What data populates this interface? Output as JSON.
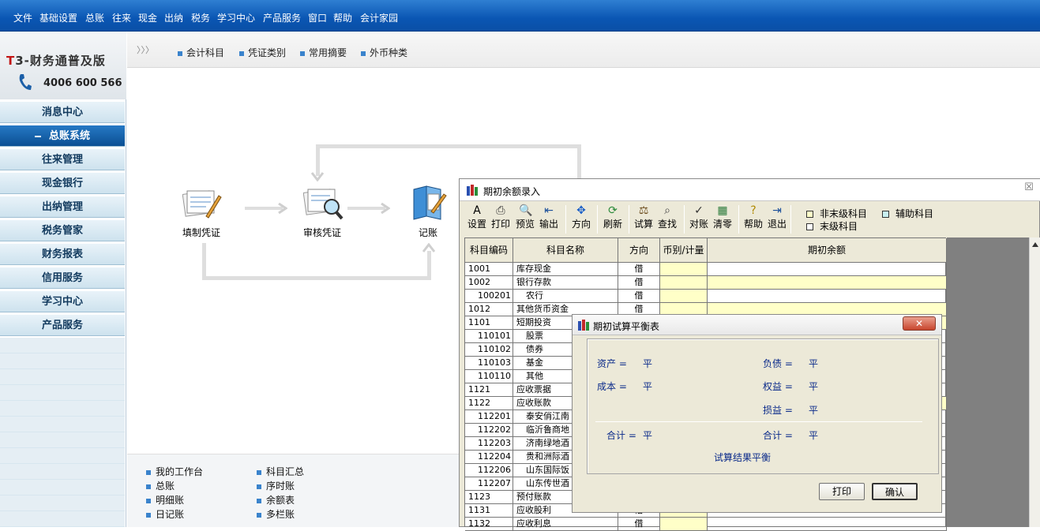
{
  "menu": [
    "文件",
    "基础设置",
    "总账",
    "往来",
    "现金",
    "出纳",
    "税务",
    "学习中心",
    "产品服务",
    "窗口",
    "帮助",
    "会计家园"
  ],
  "logo": {
    "brand_prefix": "T",
    "brand_rest": "3-财务通普及版",
    "phone": "4006 600 566"
  },
  "nav": [
    "消息中心",
    "总账系统",
    "往来管理",
    "现金银行",
    "出纳管理",
    "税务管家",
    "财务报表",
    "信用服务",
    "学习中心",
    "产品服务"
  ],
  "nav_active": 1,
  "subbar": {
    "arrows": "〉〉〉",
    "items": [
      "会计科目",
      "凭证类别",
      "常用摘要",
      "外币种类"
    ]
  },
  "flow": {
    "steps": [
      "填制凭证",
      "审核凭证",
      "记账"
    ]
  },
  "bottom_links": {
    "col1": [
      "我的工作台",
      "总账",
      "明细账",
      "日记账"
    ],
    "col2": [
      "科目汇总",
      "序时账",
      "余额表",
      "多栏账"
    ]
  },
  "main_window": {
    "title": "期初余额录入",
    "close": "☒",
    "toolbar": [
      {
        "label": "设置",
        "icon": "A"
      },
      {
        "label": "打印",
        "icon": "⎙"
      },
      {
        "label": "预览",
        "icon": "🔍"
      },
      {
        "label": "输出",
        "icon": "⇤"
      },
      {
        "label": "方向",
        "icon": "✥"
      },
      {
        "label": "刷新",
        "icon": "⟳"
      },
      {
        "label": "试算",
        "icon": "⚖"
      },
      {
        "label": "查找",
        "icon": "⌕"
      },
      {
        "label": "对账",
        "icon": "✓"
      },
      {
        "label": "清零",
        "icon": "▦"
      },
      {
        "label": "帮助",
        "icon": "?"
      },
      {
        "label": "退出",
        "icon": "⇥"
      }
    ],
    "legend": {
      "non_leaf": "非末级科目",
      "aux": "辅助科目",
      "leaf": "末级科目"
    },
    "columns": [
      "科目编码",
      "科目名称",
      "方向",
      "币别/计量",
      "期初余额"
    ],
    "rows": [
      {
        "code": "1001",
        "name": "库存现金",
        "dir": "借",
        "yellow": false,
        "indent": false
      },
      {
        "code": "1002",
        "name": "银行存款",
        "dir": "借",
        "yellow": true,
        "indent": false
      },
      {
        "code": "100201",
        "name": "农行",
        "dir": "借",
        "yellow": false,
        "indent": true
      },
      {
        "code": "1012",
        "name": "其他货币资金",
        "dir": "借",
        "yellow": true,
        "indent": false
      },
      {
        "code": "1101",
        "name": "短期投资",
        "dir": "",
        "yellow": true,
        "indent": false
      },
      {
        "code": "110101",
        "name": "股票",
        "dir": "",
        "yellow": false,
        "indent": true
      },
      {
        "code": "110102",
        "name": "债券",
        "dir": "",
        "yellow": false,
        "indent": true
      },
      {
        "code": "110103",
        "name": "基金",
        "dir": "",
        "yellow": false,
        "indent": true
      },
      {
        "code": "110110",
        "name": "其他",
        "dir": "",
        "yellow": false,
        "indent": true
      },
      {
        "code": "1121",
        "name": "应收票据",
        "dir": "",
        "yellow": false,
        "indent": false
      },
      {
        "code": "1122",
        "name": "应收账款",
        "dir": "",
        "yellow": true,
        "indent": false
      },
      {
        "code": "112201",
        "name": "泰安俏江南",
        "dir": "",
        "yellow": false,
        "indent": true
      },
      {
        "code": "112202",
        "name": "临沂鲁商地",
        "dir": "",
        "yellow": false,
        "indent": true
      },
      {
        "code": "112203",
        "name": "济南绿地酒",
        "dir": "",
        "yellow": false,
        "indent": true
      },
      {
        "code": "112204",
        "name": "贵和洲际酒",
        "dir": "",
        "yellow": false,
        "indent": true
      },
      {
        "code": "112206",
        "name": "山东国际饭",
        "dir": "",
        "yellow": false,
        "indent": true
      },
      {
        "code": "112207",
        "name": "山东传世酒",
        "dir": "",
        "yellow": false,
        "indent": true
      },
      {
        "code": "1123",
        "name": "预付账款",
        "dir": "",
        "yellow": false,
        "indent": false
      },
      {
        "code": "1131",
        "name": "应收股利",
        "dir": "借",
        "yellow": false,
        "indent": false
      },
      {
        "code": "1132",
        "name": "应收利息",
        "dir": "借",
        "yellow": false,
        "indent": false
      }
    ]
  },
  "dialog": {
    "title": "期初试算平衡表",
    "close": "✕",
    "assets_label": "资产 =",
    "assets_value": "平",
    "liab_label": "负债 =",
    "liab_value": "平",
    "cost_label": "成本 =",
    "cost_value": "平",
    "equity_label": "权益 =",
    "equity_value": "平",
    "pl_label": "损益 =",
    "pl_value": "平",
    "total_left_label": "合计 =",
    "total_left_value": "平",
    "total_right_label": "合计 =",
    "total_right_value": "平",
    "result": "试算结果平衡",
    "print": "打印",
    "ok": "确认"
  }
}
